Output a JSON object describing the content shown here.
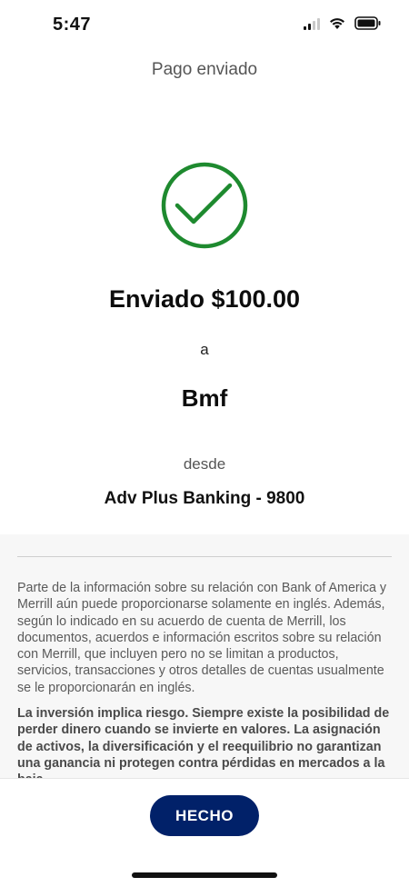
{
  "status_bar": {
    "time": "5:47",
    "signal_icon": "cellular-signal-icon",
    "wifi_icon": "wifi-icon",
    "battery_icon": "battery-icon"
  },
  "header": {
    "title": "Pago enviado"
  },
  "confirmation": {
    "icon": "checkmark-circle-icon",
    "icon_color": "#1e8a2f",
    "sent_label": "Enviado $100.00",
    "to_label": "a",
    "recipient": "Bmf",
    "from_label": "desde",
    "from_account": "Adv Plus Banking - 9800"
  },
  "disclosure": {
    "paragraph": "Parte de la información sobre su relación con Bank of America y Merrill aún puede proporcionarse solamente en inglés. Además, según lo indicado en su acuerdo de cuenta de Merrill, los documentos, acuerdos e información escritos sobre su relación con Merrill, que incluyen pero no se limitan a productos, servicios, transacciones y otros detalles de cuentas usualmente se le proporcionarán en inglés.",
    "risk_paragraph": "La inversión implica riesgo. Siempre existe la posibilidad de perder dinero cuando se invierte en valores. La asignación de activos, la diversificación y el reequilibrio no garantizan una ganancia ni protegen contra pérdidas en mercados a la baja."
  },
  "footer": {
    "done_label": "HECHO",
    "button_color": "#012169"
  }
}
